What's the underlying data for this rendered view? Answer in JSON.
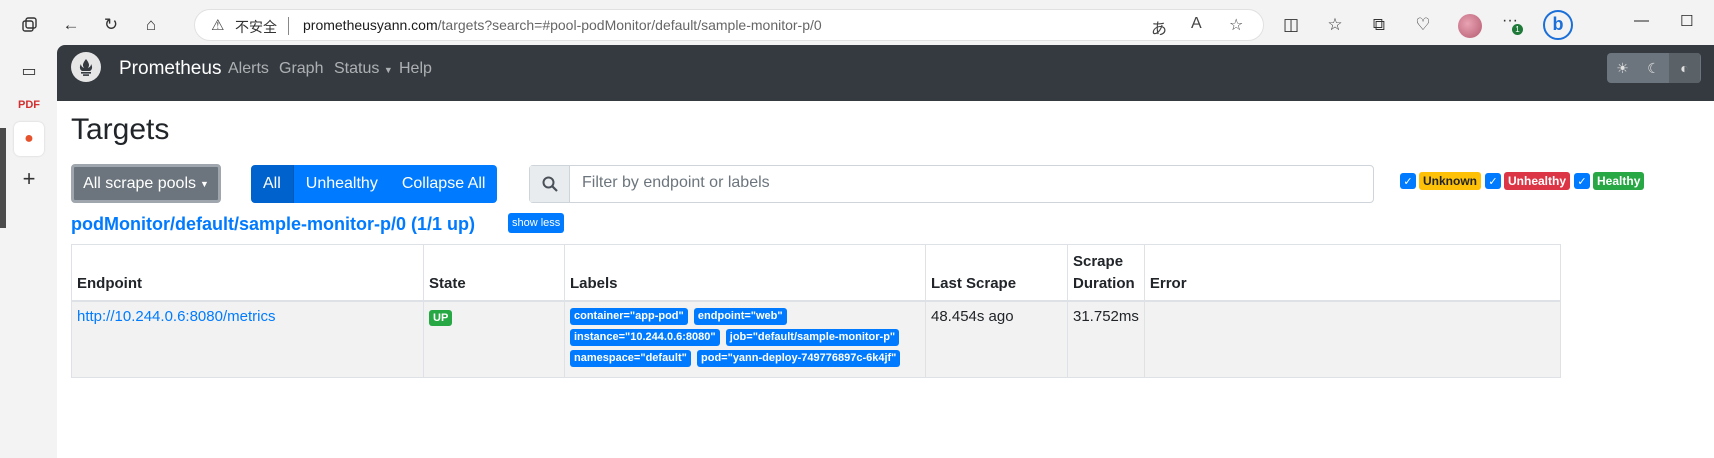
{
  "browser": {
    "security_label": "不安全",
    "url_host": "prometheusyann.com",
    "url_rest": "/targets?search=#pool-podMonitor/default/sample-monitor-p/0",
    "notification_count": "1"
  },
  "navbar": {
    "brand": "Prometheus",
    "links": [
      "Alerts",
      "Graph",
      "Status",
      "Help"
    ]
  },
  "page": {
    "title": "Targets",
    "scrape_pool_button": "All scrape pools",
    "filter_buttons": [
      "All",
      "Unhealthy",
      "Collapse All"
    ],
    "filter_placeholder": "Filter by endpoint or labels",
    "health_filters": [
      "Unknown",
      "Unhealthy",
      "Healthy"
    ]
  },
  "pool": {
    "title": "podMonitor/default/sample-monitor-p/0 (1/1 up)",
    "toggle_label": "show less",
    "columns": [
      "Endpoint",
      "State",
      "Labels",
      "Last Scrape",
      "Scrape Duration",
      "Error"
    ],
    "rows": [
      {
        "endpoint": "http://10.244.0.6:8080/metrics",
        "state": "UP",
        "labels": [
          "container=\"app-pod\"",
          "endpoint=\"web\"",
          "instance=\"10.244.0.6:8080\"",
          "job=\"default/sample-monitor-p\"",
          "namespace=\"default\"",
          "pod=\"yann-deploy-749776897c-6k4jf\""
        ],
        "last_scrape": "48.454s ago",
        "scrape_duration": "31.752ms",
        "error": ""
      }
    ]
  },
  "colors": {
    "navbar": "#343a40",
    "primary": "#007bff",
    "success": "#28a745",
    "warning": "#ffc107",
    "danger": "#dc3545"
  }
}
